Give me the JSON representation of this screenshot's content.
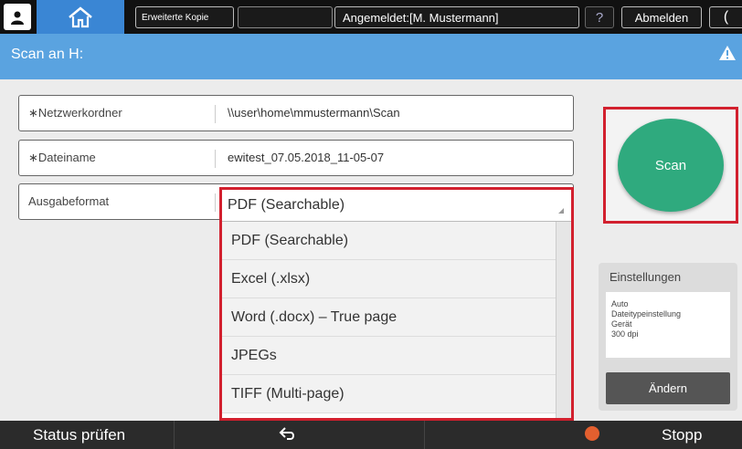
{
  "topbar": {
    "copy_label": "Erweiterte Kopie",
    "user_label": "Angemeldet:[M. Mustermann]",
    "help_label": "?",
    "logout_label": "Abmelden",
    "moon_label": "("
  },
  "header": {
    "title": "Scan an H:"
  },
  "form": {
    "folder": {
      "label": "∗Netzwerkordner",
      "value": "\\\\user\\home\\mmustermann\\Scan"
    },
    "filename": {
      "label": "∗Dateiname",
      "value": "ewitest_07.05.2018_11-05-07"
    },
    "format": {
      "label": "Ausgabeformat",
      "value": "PDF (Searchable)"
    }
  },
  "dropdown": {
    "options": [
      "PDF (Searchable)",
      "Excel (.xlsx)",
      "Word (.docx) – True page",
      "JPEGs",
      "TIFF (Multi-page)"
    ]
  },
  "scan": {
    "label": "Scan"
  },
  "settings": {
    "title": "Einstellungen",
    "lines": [
      "Auto",
      "Dateitypeinstellung",
      "Gerät",
      "300 dpi"
    ],
    "change_label": "Ändern"
  },
  "footer": {
    "status_label": "Status prüfen",
    "stop_label": "Stopp"
  },
  "colors": {
    "accent": "#5aa3e0",
    "scan_green": "#2faa7e",
    "highlight_red": "#d2202e"
  }
}
